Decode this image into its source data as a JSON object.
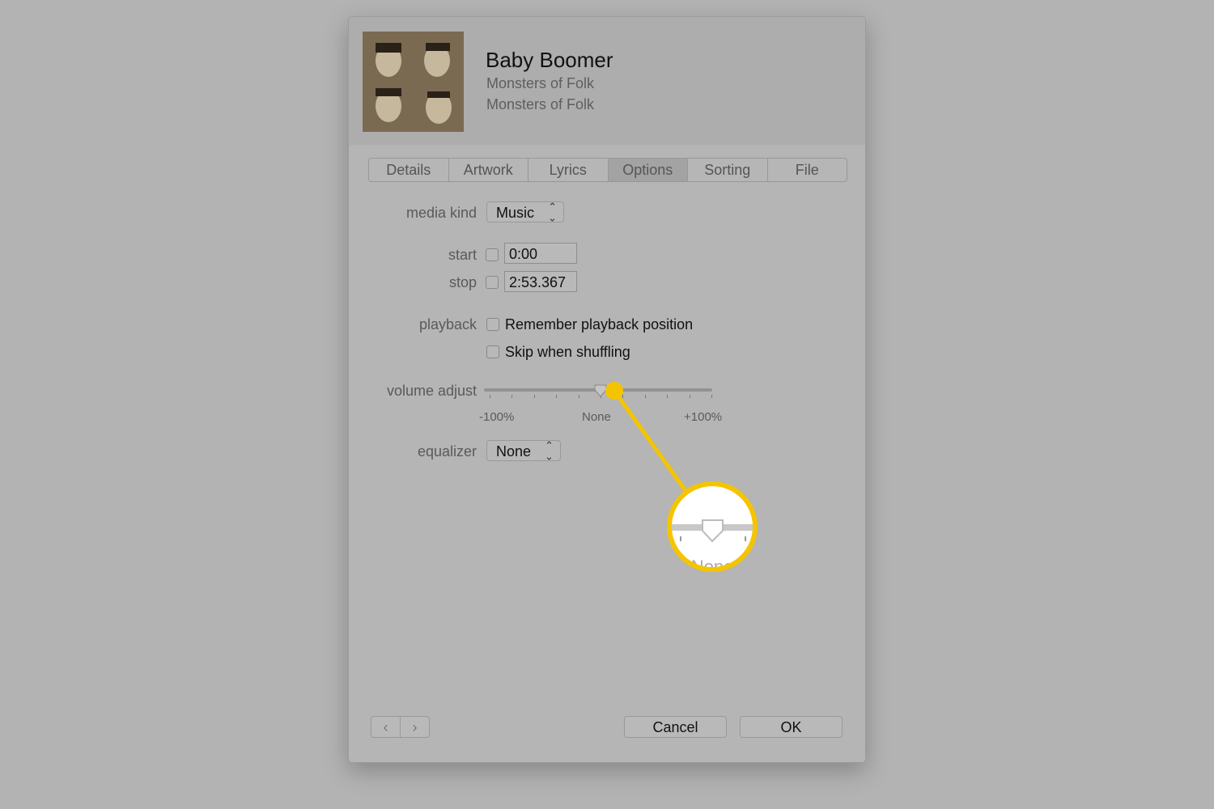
{
  "track": {
    "title": "Baby Boomer",
    "artist": "Monsters of Folk",
    "album": "Monsters of Folk"
  },
  "tabs": [
    {
      "label": "Details"
    },
    {
      "label": "Artwork"
    },
    {
      "label": "Lyrics"
    },
    {
      "label": "Options",
      "active": true
    },
    {
      "label": "Sorting"
    },
    {
      "label": "File"
    }
  ],
  "options": {
    "media_kind": {
      "label": "media kind",
      "value": "Music"
    },
    "start": {
      "label": "start",
      "value": "0:00",
      "checked": false
    },
    "stop": {
      "label": "stop",
      "value": "2:53.367",
      "checked": false
    },
    "playback": {
      "label": "playback",
      "remember": "Remember playback position",
      "skip": "Skip when shuffling"
    },
    "volume_adjust": {
      "label": "volume adjust",
      "min_label": "-100%",
      "mid_label": "None",
      "max_label": "+100%",
      "value_percent": 0
    },
    "equalizer": {
      "label": "equalizer",
      "value": "None"
    }
  },
  "footer": {
    "cancel": "Cancel",
    "ok": "OK"
  },
  "callout": {
    "color": "#f5c400",
    "zoom_text": "None"
  }
}
